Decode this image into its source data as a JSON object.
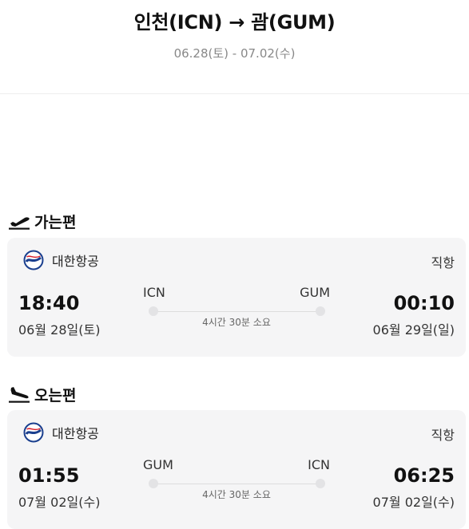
{
  "header": {
    "route_title": "인천(ICN) → 괌(GUM)",
    "date_range": "06.28(토) - 07.02(수)"
  },
  "outbound": {
    "section_label": "가는편",
    "icon": "plane-takeoff-icon",
    "airline_logo": "korean-air-logo-icon",
    "airline": "대한항공",
    "flight_type": "직항",
    "dep_time": "18:40",
    "dep_date": "06월 28일(토)",
    "dep_code": "ICN",
    "arr_code": "GUM",
    "duration": "4시간 30분 소요",
    "arr_time": "00:10",
    "arr_date": "06월 29일(일)"
  },
  "return": {
    "section_label": "오는편",
    "icon": "plane-landing-icon",
    "airline_logo": "korean-air-logo-icon",
    "airline": "대한항공",
    "flight_type": "직항",
    "dep_time": "01:55",
    "dep_date": "07월 02일(수)",
    "dep_code": "GUM",
    "arr_code": "ICN",
    "duration": "4시간 30분 소요",
    "arr_time": "06:25",
    "arr_date": "07월 02일(수)"
  },
  "colors": {
    "card_background": "#f5f5f6",
    "logo_blue": "#1a3f8e",
    "logo_red": "#d8202b"
  }
}
